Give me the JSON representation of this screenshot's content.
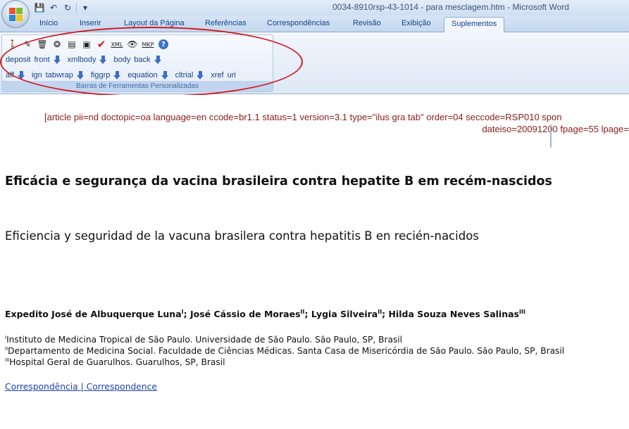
{
  "window": {
    "title": "0034-8910rsp-43-1014 - para mesclagem.htm - Microsoft Word"
  },
  "quick_access": [
    {
      "name": "save-icon",
      "glyph": "💾"
    },
    {
      "name": "undo-icon",
      "glyph": "↶"
    },
    {
      "name": "redo-icon",
      "glyph": "↻"
    },
    {
      "name": "customize-qat-icon",
      "glyph": "▾"
    }
  ],
  "tabs": [
    {
      "label": "Início"
    },
    {
      "label": "Inserir"
    },
    {
      "label": "Layout da Página"
    },
    {
      "label": "Referências"
    },
    {
      "label": "Correspondências"
    },
    {
      "label": "Revisão"
    },
    {
      "label": "Exibição"
    },
    {
      "label": "Suplementos",
      "active": true
    }
  ],
  "ribbon": {
    "group_caption": "Barras de Ferramentas Personalizadas",
    "toolbar_icons": [
      {
        "name": "person-icon",
        "glyph": "🚶"
      },
      {
        "name": "pen-icon",
        "glyph": "✎"
      },
      {
        "name": "trash-icon",
        "glyph": "🗑"
      },
      {
        "name": "brain-icon",
        "glyph": "❂"
      },
      {
        "name": "table-icon",
        "glyph": "▤"
      },
      {
        "name": "save-disk-icon",
        "glyph": "▣"
      },
      {
        "name": "checkmark-icon",
        "glyph": "✔"
      },
      {
        "name": "xml-icon",
        "glyph": "XML"
      },
      {
        "name": "eye-icon",
        "glyph": "👁"
      },
      {
        "name": "mkp-icon",
        "glyph": "MKP"
      },
      {
        "name": "help-icon",
        "glyph": "?"
      }
    ],
    "row1": {
      "deposit": "deposit",
      "front": "front",
      "xmlbody": "xmlbody",
      "body": "body",
      "back": "back"
    },
    "row2": {
      "aff": "aff",
      "ign": "ign",
      "tabwrap": "tabwrap",
      "figgrp": "figgrp",
      "equation": "equation",
      "cltrial": "cltrial",
      "xref": "xref",
      "uri": "uri"
    }
  },
  "colors": {
    "annotation": "#d41a20",
    "sgml_text": "#8b1c1c",
    "link": "#1a3fb0",
    "ribbon_text": "#15428b"
  },
  "document": {
    "sgml_line1": "[article pii=nd doctopic=oa language=en ccode=br1.1 status=1 version=3.1 type=\"ilus gra tab\" order=04 seccode=RSP010 spon",
    "sgml_line2": "dateiso=20091200 fpage=55 lpage=",
    "title_pt": "Eficácia e segurança da vacina brasileira contra hepatite B em recém-nascidos",
    "title_es": "Eficiencia y seguridad de la vacuna brasilera contra hepatitis B en recién-nacidos",
    "authors": [
      {
        "name": "Expedito José de Albuquerque Luna",
        "aff": "I"
      },
      {
        "name": "José Cássio de Moraes",
        "aff": "II"
      },
      {
        "name": "Lygia Silveira",
        "aff": "II"
      },
      {
        "name": "Hilda Souza Neves Salinas",
        "aff": "III"
      }
    ],
    "affiliations": [
      {
        "label": "I",
        "text": "Instituto de Medicina Tropical de São Paulo. Universidade de São Paulo. São Paulo, SP, Brasil"
      },
      {
        "label": "II",
        "text": "Departamento de Medicina Social. Faculdade de Ciências Médicas. Santa Casa de Misericórdia de São Paulo. São Paulo, SP, Brasil"
      },
      {
        "label": "III",
        "text": "Hospital Geral de Guarulhos. Guarulhos, SP, Brasil"
      }
    ],
    "correspondence_link": "Correspondência | Correspondence"
  }
}
